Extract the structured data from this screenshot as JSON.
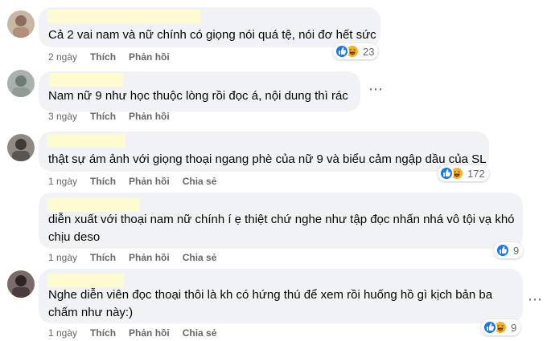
{
  "comments": [
    {
      "text": "Cả 2 vai nam và nữ chính có giọng nói quá tệ, nói đơ hết sức",
      "time": "2 ngày",
      "like": "Thích",
      "reply": "Phản hồi",
      "share": "",
      "reactions": "23"
    },
    {
      "text": "Nam nữ 9 như học thuộc lòng rồi đọc á, nội dung thì rác",
      "time": "3 ngày",
      "like": "Thích",
      "reply": "Phản hồi",
      "share": "",
      "reactions": ""
    },
    {
      "text": "thật sự ám ảnh với giọng thoại ngang phè của nữ 9 và biểu cảm ngập dầu của SL",
      "time": "1 ngày",
      "like": "Thích",
      "reply": "Phản hồi",
      "share": "Chia sẻ",
      "reactions": "172"
    },
    {
      "text": "diễn xuất với thoại nam nữ chính í ẹ thiệt chứ nghe như tập đọc nhấn nhá vô tội vạ khó chịu deso",
      "time": "1 ngày",
      "like": "Thích",
      "reply": "Phản hồi",
      "share": "Chia sẻ",
      "reactions": "9"
    },
    {
      "text": "Nghe diễn viên đọc thoại thôi là kh có hứng thú để xem rồi huống hồ gì kịch bản ba chấm như này:)",
      "time": "1 ngày",
      "like": "Thích",
      "reply": "Phản hồi",
      "share": "Chia sẻ",
      "reactions": "9"
    }
  ],
  "icons": {
    "like": "thumbs-up-icon",
    "haha": "laughing-face-icon",
    "more": "more-options-icon"
  },
  "colors": {
    "bubble": "#f0f2f5",
    "like_blue": "#1877f2",
    "haha_yellow": "#f7b125",
    "meta_gray": "#65676b",
    "name_redaction": "#fffbd1"
  }
}
